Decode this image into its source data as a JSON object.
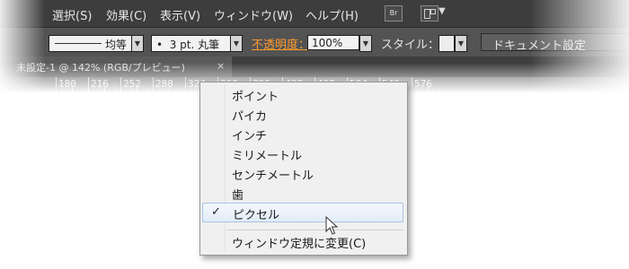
{
  "menubar": {
    "items": [
      "選択(S)",
      "効果(C)",
      "表示(V)",
      "ウィンドウ(W)",
      "ヘルプ(H)"
    ],
    "bridge_icon_label": "Br"
  },
  "controlbar": {
    "stroke_profile": "均等",
    "brush": "3 pt. 丸筆",
    "brush_bullet": "•",
    "opacity_label": "不透明度：",
    "opacity_value": "100%",
    "style_label": "スタイル：",
    "doc_settings_label": "ドキュメント設定"
  },
  "tab": {
    "title": "未設定-1 @ 142% (RGB/プレビュー)",
    "close_glyph": "×"
  },
  "ruler": {
    "labels": [
      "180",
      "216",
      "252",
      "288",
      "324",
      "360",
      "396",
      "432",
      "468",
      "504",
      "540",
      "576"
    ]
  },
  "popup": {
    "items": [
      "ポイント",
      "パイカ",
      "インチ",
      "ミリメートル",
      "センチメートル",
      "歯",
      "ピクセル"
    ],
    "selected_index": 6,
    "check_glyph": "✓",
    "footer_item": "ウィンドウ定規に変更(C)"
  },
  "colors": {
    "menubar_bg": "#3d3d3d",
    "controlbar_bg": "#535353",
    "opacity_label": "#ff9a2e",
    "highlight_border": "#a9c3e6"
  }
}
